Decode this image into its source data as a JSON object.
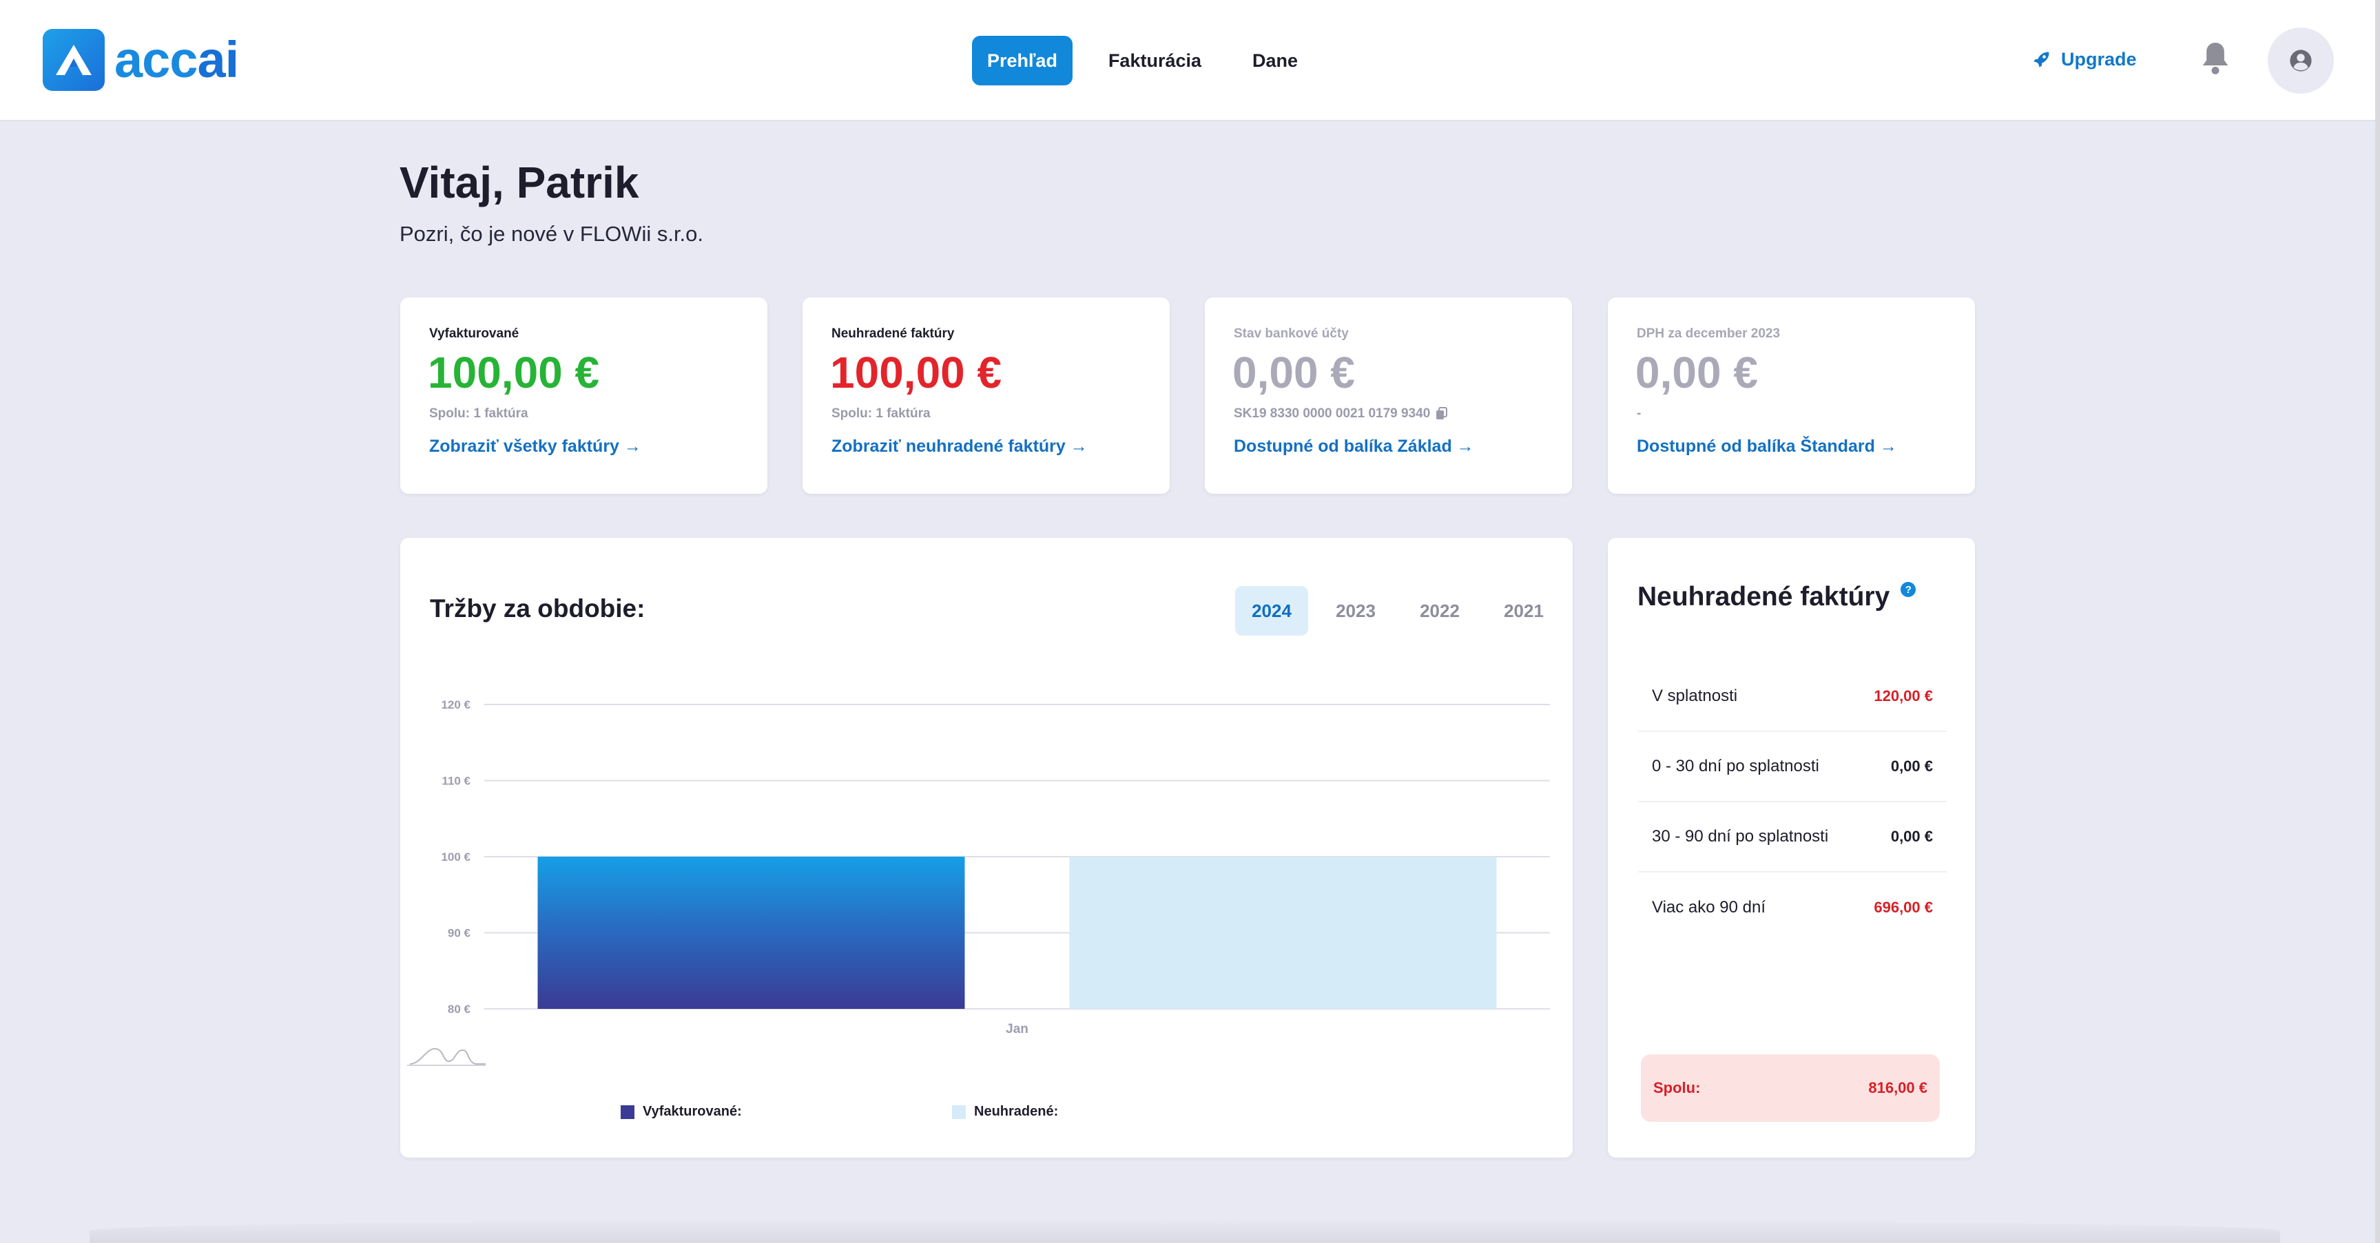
{
  "brand": {
    "name_part1": "acc",
    "name_part2": "ai"
  },
  "nav": {
    "items": [
      {
        "label": "Prehľad",
        "active": true
      },
      {
        "label": "Fakturácia",
        "active": false
      },
      {
        "label": "Dane",
        "active": false
      }
    ],
    "upgrade_label": "Upgrade"
  },
  "header": {
    "greeting": "Vitaj, Patrik",
    "subtitle": "Pozri, čo je nové v FLOWii s.r.o."
  },
  "cards": [
    {
      "label": "Vyfakturované",
      "value": "100,00 €",
      "note": "Spolu: 1 faktúra",
      "link": "Zobraziť všetky faktúry →",
      "color": "#27b336"
    },
    {
      "label": "Neuhradené faktúry",
      "value": "100,00 €",
      "note": "Spolu: 1 faktúra",
      "link": "Zobraziť neuhradené faktúry →",
      "color": "#e3242b"
    },
    {
      "label": "Stav bankové účty",
      "value": "0,00 €",
      "note": "SK19 8330 0000 0021 0179 9340",
      "link": "Dostupné od balíka Základ →",
      "color": "#a9a9b8"
    },
    {
      "label": "DPH za december 2023",
      "value": "0,00 €",
      "note": "-",
      "link": "Dostupné od balíka Štandard →",
      "color": "#a9a9b8"
    }
  ],
  "revenue": {
    "title": "Tržby za obdobie:",
    "years": [
      {
        "label": "2024",
        "active": true
      },
      {
        "label": "2023",
        "active": false
      },
      {
        "label": "2022",
        "active": false
      },
      {
        "label": "2021",
        "active": false
      }
    ]
  },
  "chart_data": {
    "type": "bar",
    "categories": [
      "Jan"
    ],
    "series": [
      {
        "name": "Vyfakturované:",
        "values": [
          100
        ],
        "color": "#3a3b94"
      },
      {
        "name": "Neuhradené:",
        "values": [
          100
        ],
        "color": "#d6ebf8"
      }
    ],
    "ylim": [
      80,
      120
    ],
    "yticks": [
      80,
      90,
      100,
      110,
      120
    ],
    "ytick_labels": [
      "80 €",
      "90 €",
      "100 €",
      "110 €",
      "120 €"
    ],
    "grid": true,
    "legend": "bottom"
  },
  "unpaid": {
    "title": "Neuhradené faktúry",
    "help": "?",
    "rows": [
      {
        "label": "V splatnosti",
        "value": "120,00 €",
        "color": "#d62027"
      },
      {
        "label": "0 - 30 dní po splatnosti",
        "value": "0,00 €",
        "color": "#1d1d2b"
      },
      {
        "label": "30 - 90 dní po splatnosti",
        "value": "0,00 €",
        "color": "#1d1d2b"
      },
      {
        "label": "Viac ako 90 dní",
        "value": "696,00 €",
        "color": "#d62027"
      }
    ],
    "total_label": "Spolu:",
    "total_value": "816,00 €"
  }
}
